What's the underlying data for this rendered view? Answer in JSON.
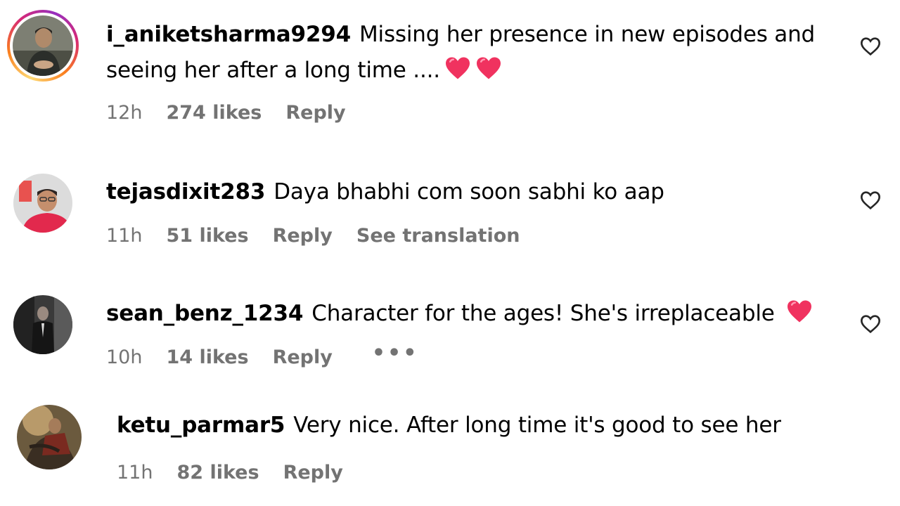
{
  "comments": [
    {
      "username": "i_aniketsharma9294",
      "text": "Missing her presence in new episodes and seeing her after a long time ....",
      "emojis": [
        "heart",
        "heart"
      ],
      "time": "12h",
      "likes": "274 likes",
      "reply": "Reply",
      "has_story_ring": true
    },
    {
      "username": "tejasdixit283",
      "text": "Daya bhabhi com soon sabhi ko aap",
      "time": "11h",
      "likes": "51 likes",
      "reply": "Reply",
      "translate": "See translation"
    },
    {
      "username": "sean_benz_1234",
      "text": "Character for the ages! She's irreplaceable",
      "emojis": [
        "heart"
      ],
      "time": "10h",
      "likes": "14 likes",
      "reply": "Reply",
      "more": "•••"
    },
    {
      "username": "ketu_parmar5",
      "text": "Very nice. After long time it's good to see her",
      "time": "11h",
      "likes": "82 likes",
      "reply": "Reply"
    }
  ],
  "colors": {
    "meta_text": "#737373",
    "heart_emoji": "#f0325f",
    "story_ring": [
      "#feda75",
      "#fa7e1e",
      "#d62976",
      "#962fbf"
    ]
  },
  "icons": {
    "like": "heart-outline-icon",
    "emoji": "red-heart-emoji"
  }
}
